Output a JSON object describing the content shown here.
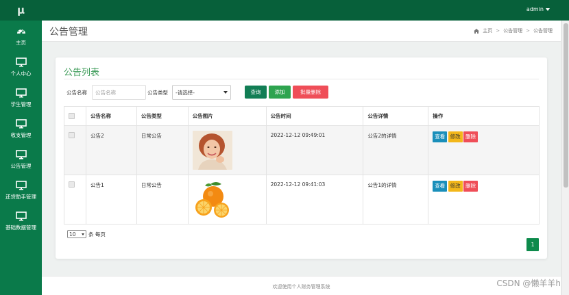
{
  "app": {
    "logo": "μ",
    "admin_label": "admin"
  },
  "sidebar": {
    "items": [
      {
        "label": "主页",
        "icon": "dashboard-icon"
      },
      {
        "label": "个人中心",
        "icon": "monitor-icon"
      },
      {
        "label": "学生管理",
        "icon": "monitor-icon"
      },
      {
        "label": "收支管理",
        "icon": "monitor-icon"
      },
      {
        "label": "公告管理",
        "icon": "monitor-icon"
      },
      {
        "label": "还贷助手管理",
        "icon": "monitor-icon"
      },
      {
        "label": "基础数据管理",
        "icon": "monitor-icon"
      }
    ]
  },
  "header": {
    "title": "公告管理",
    "breadcrumb": [
      "主页",
      "公告管理",
      "公告管理"
    ]
  },
  "card": {
    "title": "公告列表"
  },
  "search": {
    "name_label": "公告名称",
    "name_placeholder": "公告名称",
    "type_label": "公告类型",
    "type_selected": "-请选择-"
  },
  "buttons": {
    "query": "查询",
    "add": "添加",
    "batch_delete": "批量删除"
  },
  "table": {
    "headers": [
      "公告名称",
      "公告类型",
      "公告图片",
      "公告时间",
      "公告详情",
      "操作"
    ],
    "rows": [
      {
        "name": "公告2",
        "type": "日常公告",
        "image": "portrait-photo",
        "time": "2022-12-12 09:49:01",
        "detail": "公告2的详情"
      },
      {
        "name": "公告1",
        "type": "日常公告",
        "image": "orange-photo",
        "time": "2022-12-12 09:41:03",
        "detail": "公告1的详情"
      }
    ],
    "actions": {
      "view": "查看",
      "edit": "修改",
      "delete": "删除"
    }
  },
  "pagination": {
    "page_size": "10",
    "per_page_label": "条 每页",
    "current_page": "1"
  },
  "footer": {
    "text": "欢迎使用个人财务管理系统"
  },
  "watermark": "CSDN @懒羊羊h",
  "colors": {
    "sidebar_bg": "#0a7a4a",
    "topbar_bg": "#07603a",
    "title_green": "#3a9a56",
    "query_btn": "#127e55",
    "add_btn": "#2ea44f",
    "delete_btn": "#ef4e58",
    "view_btn": "#1a8fba",
    "edit_btn": "#f3b71a"
  }
}
